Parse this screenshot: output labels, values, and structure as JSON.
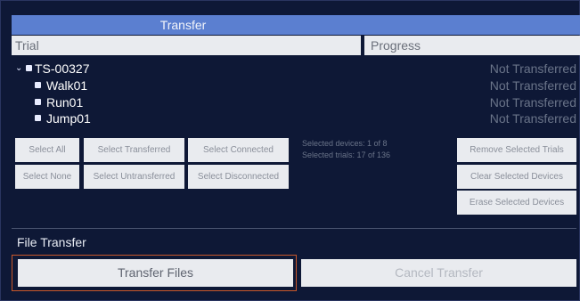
{
  "window": {
    "title": "Transfer"
  },
  "columns": {
    "trial": "Trial",
    "progress": "Progress"
  },
  "tree": {
    "root": {
      "label": "TS-00327",
      "status": "Not Transferred"
    },
    "children": [
      {
        "label": "Walk01",
        "status": "Not Transferred"
      },
      {
        "label": "Run01",
        "status": "Not Transferred"
      },
      {
        "label": "Jump01",
        "status": "Not Transferred"
      }
    ]
  },
  "buttons": {
    "select_all": "Select All",
    "select_none": "Select None",
    "select_transferred": "Select Transferred",
    "select_untransferred": "Select Untransferred",
    "select_connected": "Select Connected",
    "select_disconnected": "Select Disconnected",
    "remove_selected_trials": "Remove Selected Trials",
    "clear_selected_devices": "Clear Selected Devices",
    "erase_selected_devices": "Erase Selected Devices"
  },
  "selection_info": {
    "devices": "Selected devices: 1 of 8",
    "trials": "Selected trials: 17 of 136"
  },
  "file_transfer": {
    "title": "File Transfer",
    "transfer_label": "Transfer Files",
    "cancel_label": "Cancel Transfer"
  },
  "colors": {
    "background": "#0e1836",
    "title_bar": "#5b7fd0",
    "focus_border": "#c9582a",
    "status_text": "#6a7489"
  },
  "icons": {
    "expand": "chevron-down-icon",
    "checkbox": "checkbox-checked-icon"
  }
}
